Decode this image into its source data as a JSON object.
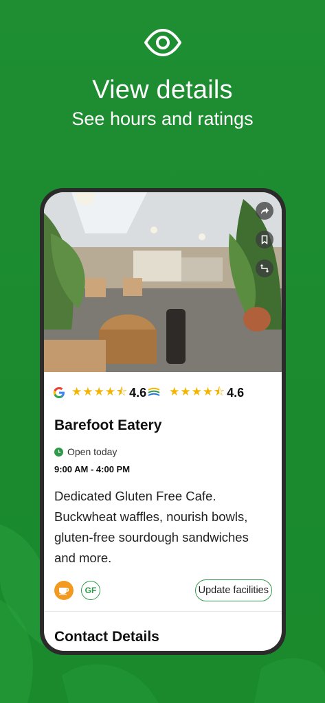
{
  "hero": {
    "title": "View details",
    "subtitle": "See hours and ratings",
    "icon": "eye-icon"
  },
  "place": {
    "name": "Barefoot Eatery",
    "status": "Open today",
    "hours": "9:00 AM - 4:00 PM",
    "description": "Dedicated Gluten Free Cafe. Buckwheat waffles, nourish bowls, gluten-free sourdough sandwiches and more."
  },
  "ratings": {
    "google": {
      "source_icon": "google-logo-icon",
      "stars": 4.6,
      "value": "4.6"
    },
    "app": {
      "source_icon": "app-logo-icon",
      "stars": 4.6,
      "value": "4.6"
    }
  },
  "actions": {
    "share_icon": "share-icon",
    "bookmark_icon": "bookmark-icon",
    "directions_icon": "directions-icon"
  },
  "facilities": {
    "icons": [
      "coffee-icon",
      "gluten-free-icon"
    ],
    "gf_label": "GF",
    "update_label": "Update facilities"
  },
  "contact": {
    "title": "Contact Details"
  },
  "colors": {
    "background": "#1f8e32",
    "accent": "#2e9a4a",
    "star": "#f4b400",
    "coffee": "#f29a1f"
  }
}
